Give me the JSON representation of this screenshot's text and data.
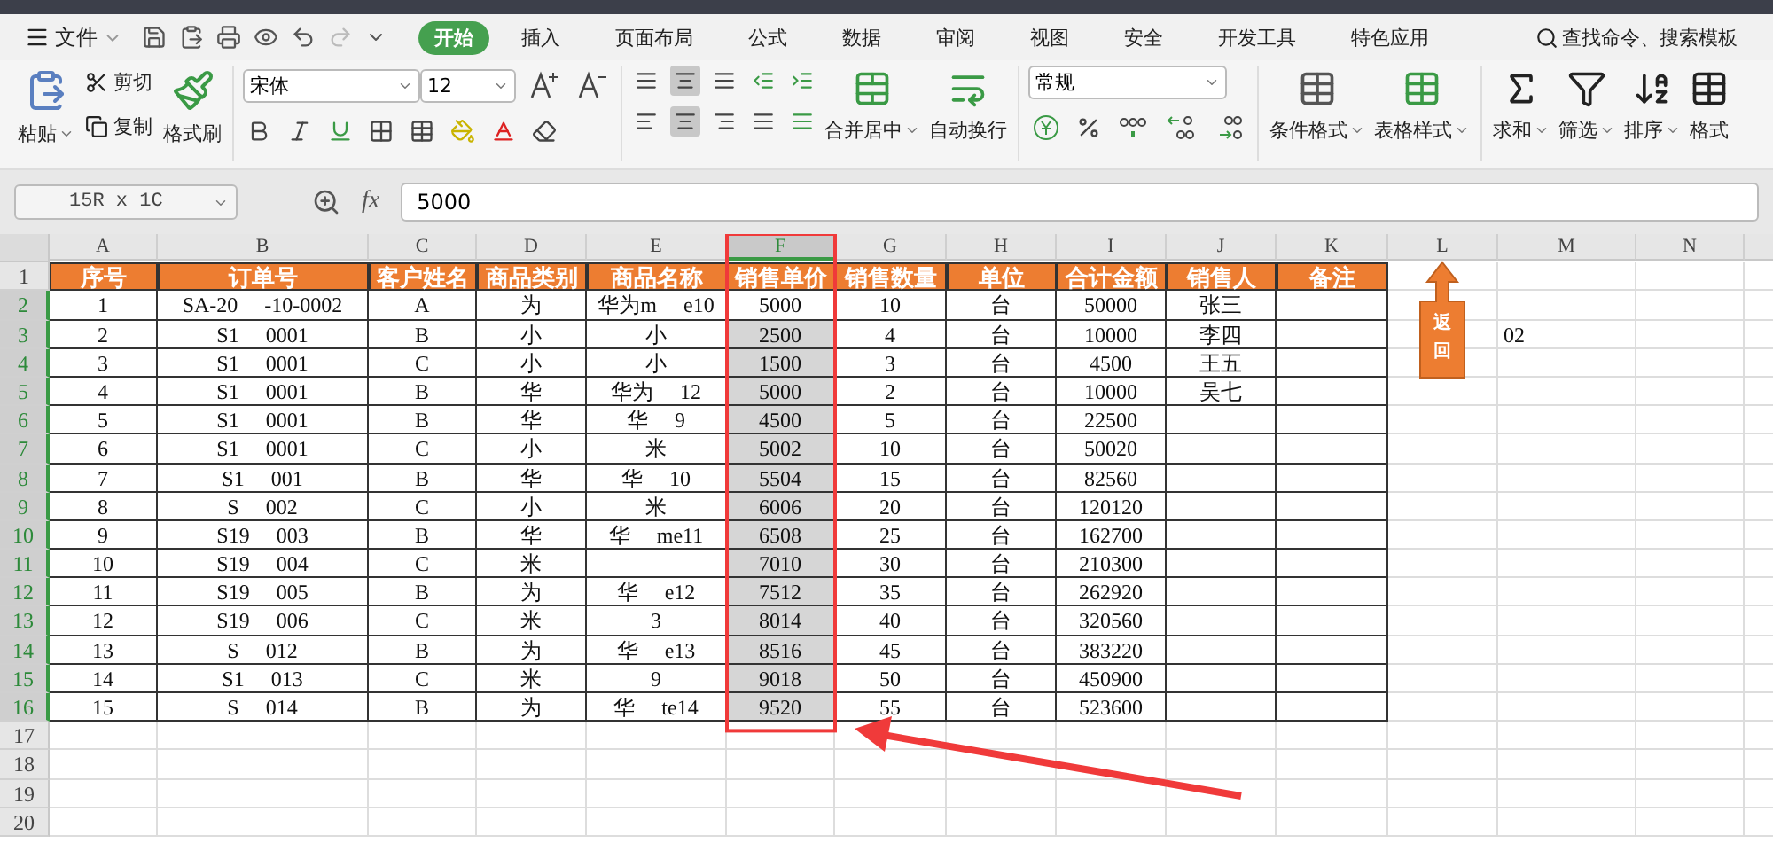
{
  "menu": {
    "file": "文件",
    "tabs": [
      {
        "label": "开始",
        "selected": true
      },
      {
        "label": "插入",
        "selected": false
      },
      {
        "label": "页面布局",
        "selected": false
      },
      {
        "label": "公式",
        "selected": false
      },
      {
        "label": "数据",
        "selected": false
      },
      {
        "label": "审阅",
        "selected": false
      },
      {
        "label": "视图",
        "selected": false
      },
      {
        "label": "安全",
        "selected": false
      },
      {
        "label": "开发工具",
        "selected": false
      },
      {
        "label": "特色应用",
        "selected": false
      }
    ],
    "search": "查找命令、搜索模板"
  },
  "ribbon": {
    "paste": "粘贴",
    "cut": "剪切",
    "copy": "复制",
    "format_painter": "格式刷",
    "font_name": "宋体",
    "font_size": "12",
    "merge": "合并居中",
    "wrap": "自动换行",
    "number_format": "常规",
    "conditional": "条件格式",
    "table_style": "表格样式",
    "sum": "求和",
    "filter": "筛选",
    "sort": "排序",
    "format": "格式"
  },
  "formula_bar": {
    "name_box": "15R x 1C",
    "fx": "fx",
    "value": "5000"
  },
  "columns": [
    {
      "letter": "A",
      "selected": false
    },
    {
      "letter": "B",
      "selected": false
    },
    {
      "letter": "C",
      "selected": false
    },
    {
      "letter": "D",
      "selected": false
    },
    {
      "letter": "E",
      "selected": false
    },
    {
      "letter": "F",
      "selected": true
    },
    {
      "letter": "G",
      "selected": false
    },
    {
      "letter": "H",
      "selected": false
    },
    {
      "letter": "I",
      "selected": false
    },
    {
      "letter": "J",
      "selected": false
    },
    {
      "letter": "K",
      "selected": false
    },
    {
      "letter": "L",
      "selected": false
    },
    {
      "letter": "M",
      "selected": false
    },
    {
      "letter": "N",
      "selected": false
    }
  ],
  "header_row": {
    "number": "1",
    "cells": [
      "序号",
      "订单号",
      "客户姓名",
      "商品类别",
      "商品名称",
      "销售单价",
      "销售数量",
      "单位",
      "合计金额",
      "销售人",
      "备注"
    ]
  },
  "rows": [
    {
      "number": "2",
      "selected": true,
      "active": true,
      "cells": [
        "1",
        "SA-20     -10-0002",
        "A",
        "为",
        "华为m     e10",
        "5000",
        "10",
        "台",
        "50000",
        "张三",
        null
      ],
      "extra": null
    },
    {
      "number": "3",
      "selected": true,
      "active": false,
      "cells": [
        "2",
        "S1     0001",
        "B",
        "小",
        "小",
        "2500",
        "4",
        "台",
        "10000",
        "李四",
        null
      ],
      "extra": "02"
    },
    {
      "number": "4",
      "selected": true,
      "active": false,
      "cells": [
        "3",
        "S1     0001",
        "C",
        "小",
        "小",
        "1500",
        "3",
        "台",
        "4500",
        "王五",
        null
      ],
      "extra": null
    },
    {
      "number": "5",
      "selected": true,
      "active": false,
      "cells": [
        "4",
        "S1     0001",
        "B",
        "华",
        "华为     12",
        "5000",
        "2",
        "台",
        "10000",
        "吴七",
        null
      ],
      "extra": null
    },
    {
      "number": "6",
      "selected": true,
      "active": false,
      "cells": [
        "5",
        "S1     0001",
        "B",
        "华",
        "华     9",
        "4500",
        "5",
        "台",
        "22500",
        null,
        null
      ],
      "extra": null
    },
    {
      "number": "7",
      "selected": true,
      "active": false,
      "cells": [
        "6",
        "S1     0001",
        "C",
        "小",
        "米",
        "5002",
        "10",
        "台",
        "50020",
        null,
        null
      ],
      "extra": null
    },
    {
      "number": "8",
      "selected": true,
      "active": false,
      "cells": [
        "7",
        "S1     001",
        "B",
        "华",
        "华     10",
        "5504",
        "15",
        "台",
        "82560",
        null,
        null
      ],
      "extra": null
    },
    {
      "number": "9",
      "selected": true,
      "active": false,
      "cells": [
        "8",
        "S     002",
        "C",
        "小",
        "米",
        "6006",
        "20",
        "台",
        "120120",
        null,
        null
      ],
      "extra": null
    },
    {
      "number": "10",
      "selected": true,
      "active": false,
      "cells": [
        "9",
        "S19     003",
        "B",
        "华",
        "华     me11",
        "6508",
        "25",
        "台",
        "162700",
        null,
        null
      ],
      "extra": null
    },
    {
      "number": "11",
      "selected": true,
      "active": false,
      "cells": [
        "10",
        "S19     004",
        "C",
        "米",
        null,
        "7010",
        "30",
        "台",
        "210300",
        null,
        null
      ],
      "extra": null
    },
    {
      "number": "12",
      "selected": true,
      "active": false,
      "cells": [
        "11",
        "S19     005",
        "B",
        "为",
        "华     e12",
        "7512",
        "35",
        "台",
        "262920",
        null,
        null
      ],
      "extra": null
    },
    {
      "number": "13",
      "selected": true,
      "active": false,
      "cells": [
        "12",
        "S19     006",
        "C",
        "米",
        "3",
        "8014",
        "40",
        "台",
        "320560",
        null,
        null
      ],
      "extra": null
    },
    {
      "number": "14",
      "selected": true,
      "active": false,
      "cells": [
        "13",
        "S     012",
        "B",
        "为",
        "华     e13",
        "8516",
        "45",
        "台",
        "383220",
        null,
        null
      ],
      "extra": null
    },
    {
      "number": "15",
      "selected": true,
      "active": false,
      "cells": [
        "14",
        "S1     013",
        "C",
        "米",
        "9",
        "9018",
        "50",
        "台",
        "450900",
        null,
        null
      ],
      "extra": null
    },
    {
      "number": "16",
      "selected": true,
      "active": false,
      "cells": [
        "15",
        "S     014",
        "B",
        "为",
        "华     te14",
        "9520",
        "55",
        "台",
        "523600",
        null,
        null
      ],
      "extra": null
    }
  ],
  "empty_rows": [
    "17",
    "18",
    "19",
    "20"
  ],
  "shape": {
    "label": "返回"
  }
}
